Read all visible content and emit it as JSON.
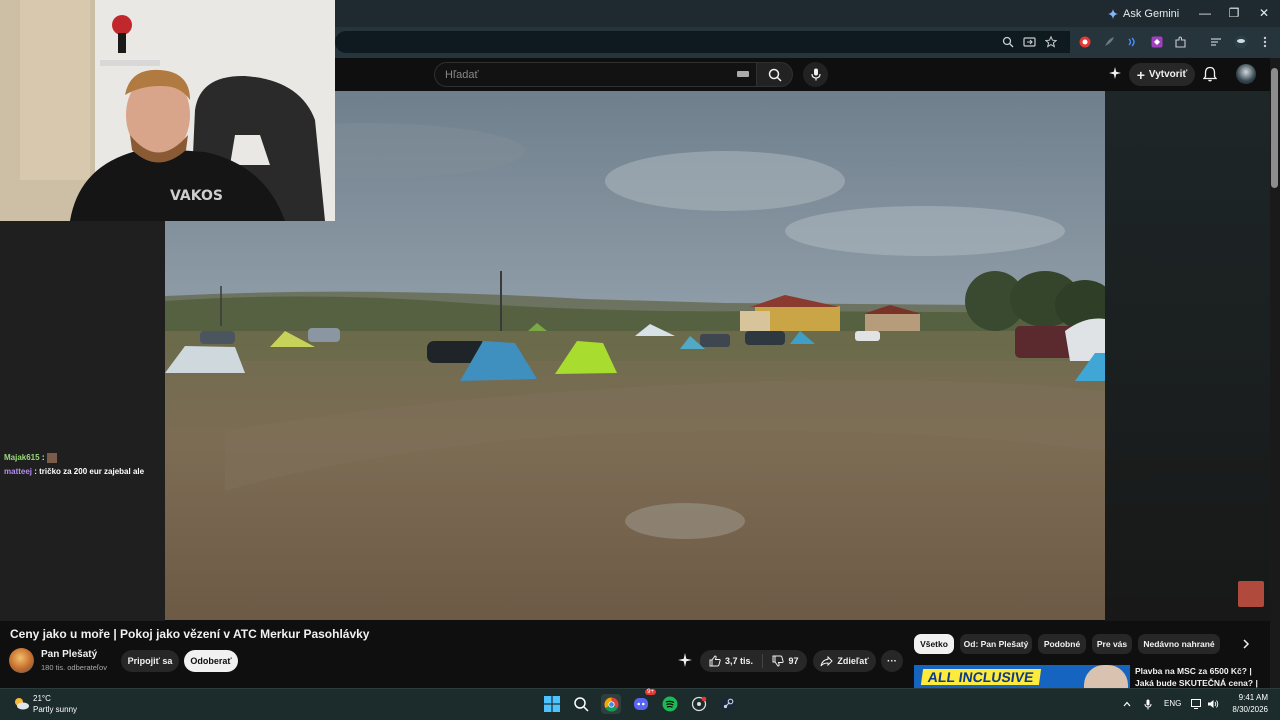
{
  "browser": {
    "ask_gemini": "Ask Gemini",
    "window_controls": {
      "minimize": "—",
      "maximize": "❐",
      "close": "✕"
    }
  },
  "youtube_header": {
    "search_placeholder": "Hľadať",
    "create_label": "Vytvoriť"
  },
  "chat": {
    "messages": [
      {
        "user": "Majak615",
        "text": "",
        "user_color": "#9ad87a"
      },
      {
        "user": "matteej",
        "text": "tričko za 200 eur zajebal ale",
        "user_color": "#b48cf0"
      }
    ]
  },
  "video": {
    "title": "Ceny jako u moře | Pokoj jako vězení v ATC Merkur Pasohlávky",
    "channel_name": "Pan Plešatý",
    "subscribers": "180 tis. odberateľov",
    "join_label": "Pripojiť sa",
    "subscribe_label": "Odoberať",
    "likes": "3,7 tis.",
    "dislikes": "97",
    "share_label": "Zdieľať",
    "more_label": "···"
  },
  "chips": [
    "Všetko",
    "Od: Pan Plešatý",
    "Podobné",
    "Pre vás",
    "Nedávno nahrané"
  ],
  "recommendation": {
    "thumb_text": "ALL INCLUSIVE",
    "title": "Plavba na MSC za 6500 Kč? | Jaká bude SKUTEČNÁ cena? |"
  },
  "taskbar": {
    "weather_temp": "21°C",
    "weather_desc": "Partly sunny",
    "discord_badge": "9+",
    "language": "ENG",
    "time": "9:41 AM",
    "date": "8/30/2026"
  }
}
